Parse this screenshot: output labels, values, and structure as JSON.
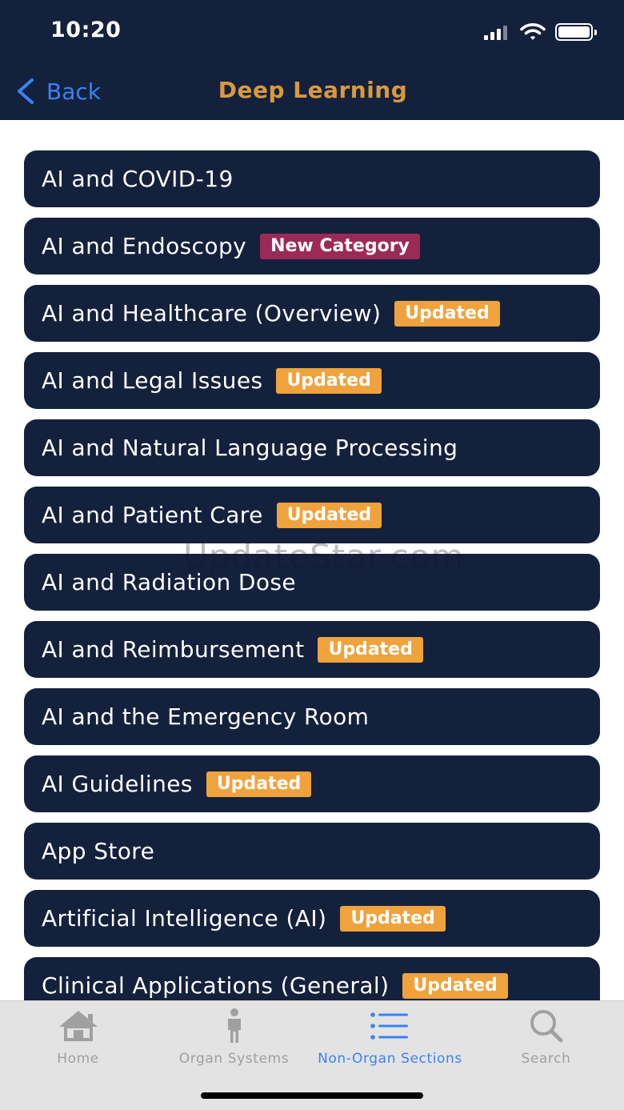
{
  "status_bar": {
    "time": "10:20"
  },
  "nav": {
    "back_label": "Back",
    "title": "Deep Learning"
  },
  "items": [
    {
      "label": "AI and COVID-19",
      "badge": null,
      "badge_type": null
    },
    {
      "label": "AI and Endoscopy",
      "badge": "New Category",
      "badge_type": "new"
    },
    {
      "label": "AI and Healthcare (Overview)",
      "badge": "Updated",
      "badge_type": "updated"
    },
    {
      "label": "AI and Legal Issues",
      "badge": "Updated",
      "badge_type": "updated"
    },
    {
      "label": "AI and Natural Language Processing",
      "badge": null,
      "badge_type": null
    },
    {
      "label": "AI and Patient Care",
      "badge": "Updated",
      "badge_type": "updated"
    },
    {
      "label": "AI and Radiation Dose",
      "badge": null,
      "badge_type": null
    },
    {
      "label": "AI and Reimbursement",
      "badge": "Updated",
      "badge_type": "updated"
    },
    {
      "label": "AI and the Emergency Room",
      "badge": null,
      "badge_type": null
    },
    {
      "label": "AI Guidelines",
      "badge": "Updated",
      "badge_type": "updated"
    },
    {
      "label": "App Store",
      "badge": null,
      "badge_type": null
    },
    {
      "label": "Artificial Intelligence (AI)",
      "badge": "Updated",
      "badge_type": "updated"
    },
    {
      "label": "Clinical Applications (General)",
      "badge": "Updated",
      "badge_type": "updated"
    }
  ],
  "watermark": "UpdateStar.com",
  "tabs": [
    {
      "label": "Home",
      "icon": "house-icon",
      "active": false
    },
    {
      "label": "Organ Systems",
      "icon": "person-icon",
      "active": false
    },
    {
      "label": "Non-Organ Sections",
      "icon": "list-icon",
      "active": true
    },
    {
      "label": "Search",
      "icon": "magnifier-icon",
      "active": false
    }
  ],
  "colors": {
    "navy": "#14213d",
    "accent_blue": "#3a82f7",
    "title_gold": "#d99a3c",
    "badge_updated": "#f0a23c",
    "badge_new": "#9b2a57",
    "tab_inactive": "#a0a0a0",
    "tabbar_bg": "#e3e3e3"
  }
}
